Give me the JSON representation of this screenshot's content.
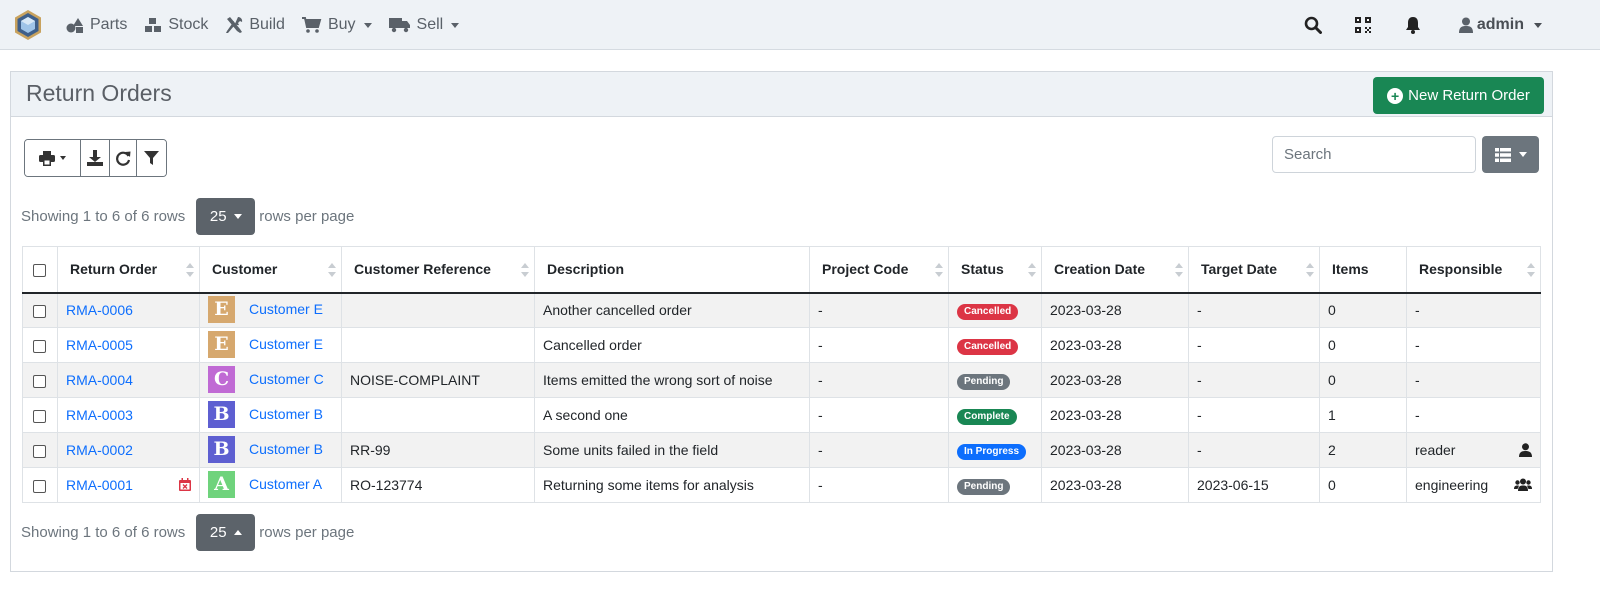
{
  "nav": {
    "items": [
      {
        "label": "Parts",
        "icon": "shapes-icon"
      },
      {
        "label": "Stock",
        "icon": "boxes-icon"
      },
      {
        "label": "Build",
        "icon": "tools-icon"
      },
      {
        "label": "Buy",
        "icon": "shopping-cart-icon"
      },
      {
        "label": "Sell",
        "icon": "truck-icon"
      }
    ],
    "user": "admin"
  },
  "page": {
    "title": "Return Orders",
    "new_button": "New Return Order",
    "search_placeholder": "Search"
  },
  "pager": {
    "top_text": "Showing 1 to 6 of 6 rows",
    "bottom_text": "Showing 1 to 6 of 6 rows",
    "page_size": "25",
    "suffix": "rows per page"
  },
  "table": {
    "headers": [
      "Return Order",
      "Customer",
      "Customer Reference",
      "Description",
      "Project Code",
      "Status",
      "Creation Date",
      "Target Date",
      "Items",
      "Responsible"
    ],
    "rows": [
      {
        "order": "RMA-0006",
        "overdue": false,
        "customer": "Customer E",
        "avatar": "E",
        "avatar_color": "#d6a86e",
        "reference": "",
        "description": "Another cancelled order",
        "project": "-",
        "status": "Cancelled",
        "status_color": "#dc3545",
        "created": "2023-03-28",
        "target": "-",
        "items": "0",
        "responsible": "-",
        "resp_icon": ""
      },
      {
        "order": "RMA-0005",
        "overdue": false,
        "customer": "Customer E",
        "avatar": "E",
        "avatar_color": "#d6a86e",
        "reference": "",
        "description": "Cancelled order",
        "project": "-",
        "status": "Cancelled",
        "status_color": "#dc3545",
        "created": "2023-03-28",
        "target": "-",
        "items": "0",
        "responsible": "-",
        "resp_icon": ""
      },
      {
        "order": "RMA-0004",
        "overdue": false,
        "customer": "Customer C",
        "avatar": "C",
        "avatar_color": "#c06ad4",
        "reference": "NOISE-COMPLAINT",
        "description": "Items emitted the wrong sort of noise",
        "project": "-",
        "status": "Pending",
        "status_color": "#6c757d",
        "created": "2023-03-28",
        "target": "-",
        "items": "0",
        "responsible": "-",
        "resp_icon": ""
      },
      {
        "order": "RMA-0003",
        "overdue": false,
        "customer": "Customer B",
        "avatar": "B",
        "avatar_color": "#5e5fd1",
        "reference": "",
        "description": "A second one",
        "project": "-",
        "status": "Complete",
        "status_color": "#198754",
        "created": "2023-03-28",
        "target": "-",
        "items": "1",
        "responsible": "-",
        "resp_icon": ""
      },
      {
        "order": "RMA-0002",
        "overdue": false,
        "customer": "Customer B",
        "avatar": "B",
        "avatar_color": "#5e5fd1",
        "reference": "RR-99",
        "description": "Some units failed in the field",
        "project": "-",
        "status": "In Progress",
        "status_color": "#0d6efd",
        "created": "2023-03-28",
        "target": "-",
        "items": "2",
        "responsible": "reader",
        "resp_icon": "user-icon"
      },
      {
        "order": "RMA-0001",
        "overdue": true,
        "customer": "Customer A",
        "avatar": "A",
        "avatar_color": "#6fd37c",
        "reference": "RO-123774",
        "description": "Returning some items for analysis",
        "project": "-",
        "status": "Pending",
        "status_color": "#6c757d",
        "created": "2023-03-28",
        "target": "2023-06-15",
        "items": "0",
        "responsible": "engineering",
        "resp_icon": "users-icon"
      }
    ]
  }
}
